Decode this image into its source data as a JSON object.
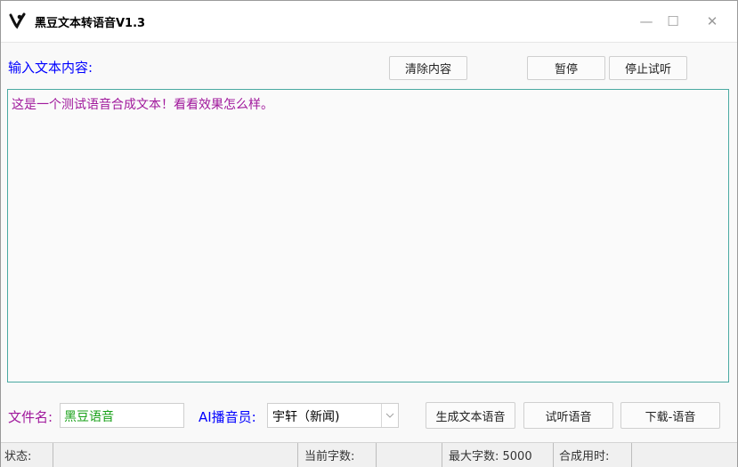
{
  "window": {
    "title": "黑豆文本转语音V1.3",
    "icon": "app-logo-icon",
    "controls": {
      "minimize": "—",
      "maximize": "☐",
      "close": "✕"
    }
  },
  "main": {
    "input_label": "输入文本内容:",
    "buttons": {
      "clear": "清除内容",
      "pause": "暂停",
      "stop_preview": "停止试听"
    },
    "text_content": "这是一个测试语音合成文本！看看效果怎么样。"
  },
  "bottom": {
    "filename_label": "文件名:",
    "filename_value": "黑豆语音",
    "voice_label": "AI播音员:",
    "voice_selected": "宇轩（新闻)",
    "buttons": {
      "generate": "生成文本语音",
      "preview": "试听语音",
      "download": "下载-语音"
    }
  },
  "statusbar": {
    "status_label": "状态:",
    "status_value": "",
    "count_label": "当前字数:",
    "count_value": "",
    "max_chars": "最大字数: 5000",
    "time_label": "合成用时:",
    "time_value": ""
  },
  "colors": {
    "label_blue": "#0000ff",
    "text_purple": "#a0189c",
    "filename_green": "#17a017",
    "textarea_border": "#4aa9a2"
  }
}
